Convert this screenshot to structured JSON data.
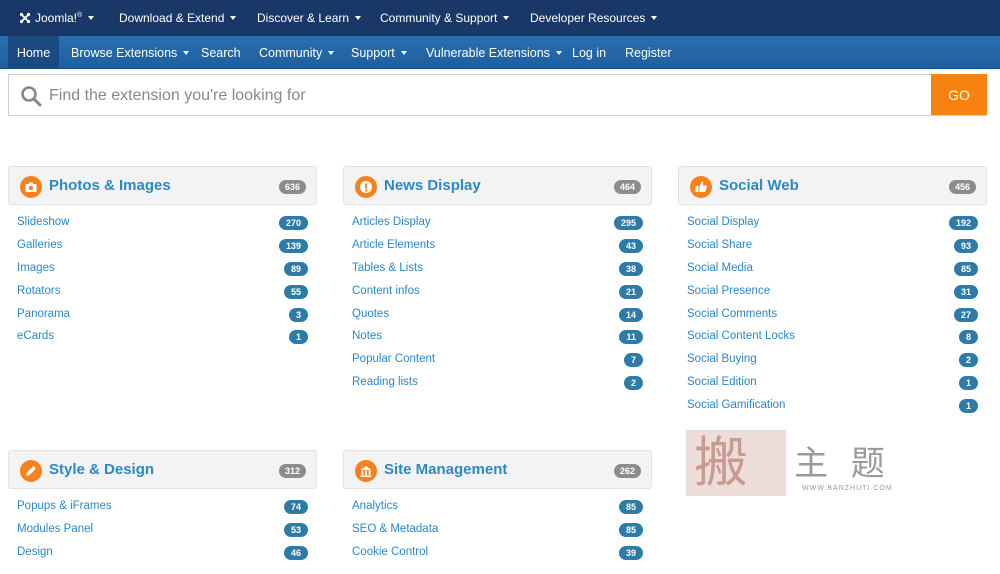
{
  "topnav": {
    "items": [
      {
        "label": "Joomla!®",
        "has_dropdown": true
      },
      {
        "label": "Download & Extend",
        "has_dropdown": true
      },
      {
        "label": "Discover & Learn",
        "has_dropdown": true
      },
      {
        "label": "Community & Support",
        "has_dropdown": true
      },
      {
        "label": "Developer Resources",
        "has_dropdown": true
      }
    ]
  },
  "subnav": {
    "items": [
      {
        "label": "Home",
        "active": true,
        "has_dropdown": false
      },
      {
        "label": "Browse Extensions",
        "has_dropdown": true
      },
      {
        "label": "Search",
        "has_dropdown": false
      },
      {
        "label": "Community",
        "has_dropdown": true
      },
      {
        "label": "Support",
        "has_dropdown": true
      },
      {
        "label": "Vulnerable Extensions",
        "has_dropdown": true
      },
      {
        "label": "Log in",
        "has_dropdown": false
      },
      {
        "label": "Register",
        "has_dropdown": false
      }
    ]
  },
  "search": {
    "placeholder": "Find the extension you're looking for",
    "value": "",
    "go_label": "GO",
    "icon": "search-icon"
  },
  "colors": {
    "topbar": "#1a3867",
    "subbar": "#2a6fb0",
    "accent": "#f7820f",
    "link": "#2b86c5",
    "badge": "#2f7ba8",
    "total_badge": "#8c8c8c"
  },
  "categories": [
    {
      "title": "Photos & Images",
      "count": "636",
      "icon": "camera-icon",
      "items": [
        {
          "label": "Slideshow",
          "count": "270"
        },
        {
          "label": "Galleries",
          "count": "139"
        },
        {
          "label": "Images",
          "count": "89"
        },
        {
          "label": "Rotators",
          "count": "55"
        },
        {
          "label": "Panorama",
          "count": "3"
        },
        {
          "label": "eCards",
          "count": "1"
        }
      ]
    },
    {
      "title": "News Display",
      "count": "464",
      "icon": "exclamation-icon",
      "items": [
        {
          "label": "Articles Display",
          "count": "295"
        },
        {
          "label": "Article Elements",
          "count": "43"
        },
        {
          "label": "Tables & Lists",
          "count": "38"
        },
        {
          "label": "Content infos",
          "count": "21"
        },
        {
          "label": "Quotes",
          "count": "14"
        },
        {
          "label": "Notes",
          "count": "11"
        },
        {
          "label": "Popular Content",
          "count": "7"
        },
        {
          "label": "Reading lists",
          "count": "2"
        }
      ]
    },
    {
      "title": "Social Web",
      "count": "456",
      "icon": "thumbs-up-icon",
      "items": [
        {
          "label": "Social Display",
          "count": "192"
        },
        {
          "label": "Social Share",
          "count": "93"
        },
        {
          "label": "Social Media",
          "count": "85"
        },
        {
          "label": "Social Presence",
          "count": "31"
        },
        {
          "label": "Social Comments",
          "count": "27"
        },
        {
          "label": "Social Content Locks",
          "count": "8"
        },
        {
          "label": "Social Buying",
          "count": "2"
        },
        {
          "label": "Social Edition",
          "count": "1"
        },
        {
          "label": "Social Gamification",
          "count": "1"
        }
      ]
    },
    {
      "title": "Style & Design",
      "count": "312",
      "icon": "pencil-icon",
      "items": [
        {
          "label": "Popups & iFrames",
          "count": "74"
        },
        {
          "label": "Modules Panel",
          "count": "53"
        },
        {
          "label": "Design",
          "count": "46"
        }
      ]
    },
    {
      "title": "Site Management",
      "count": "262",
      "icon": "building-icon",
      "items": [
        {
          "label": "Analytics",
          "count": "85"
        },
        {
          "label": "SEO & Metadata",
          "count": "85"
        },
        {
          "label": "Cookie Control",
          "count": "39"
        }
      ]
    }
  ],
  "watermark": {
    "chars": "主 题",
    "url": "WWW.BANZHUTI.COM",
    "seal": "搬"
  }
}
